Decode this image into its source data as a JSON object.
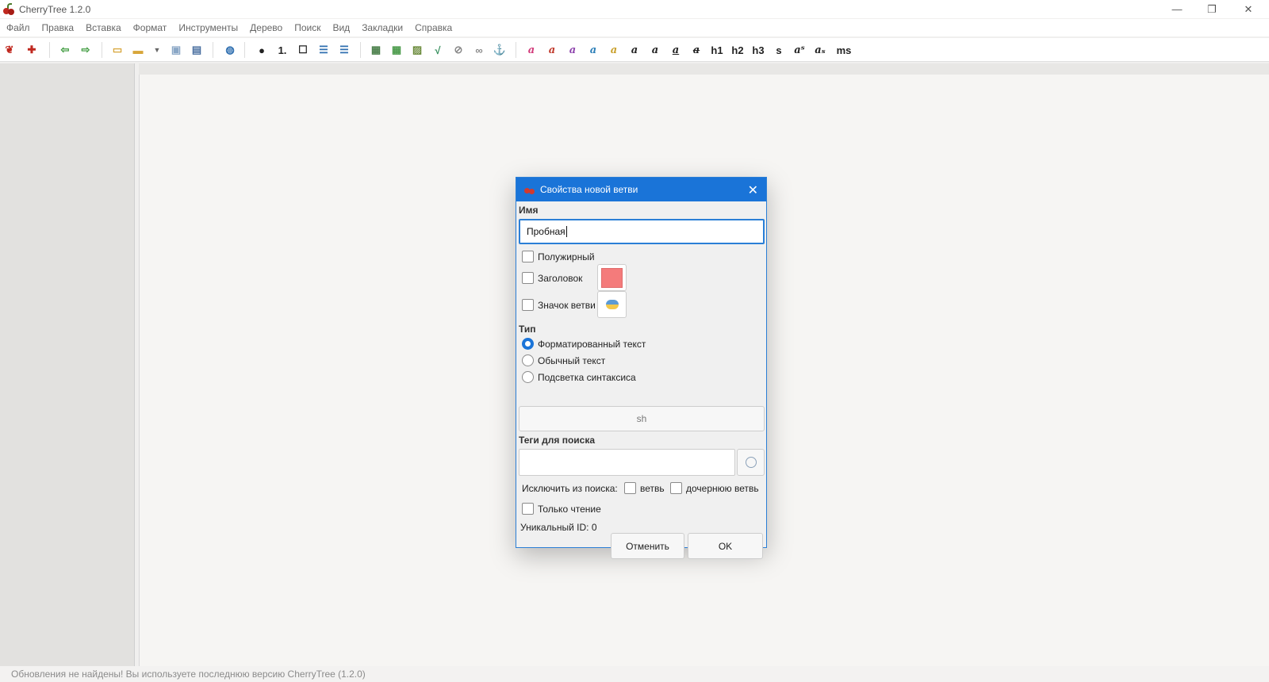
{
  "window": {
    "title": "CherryTree 1.2.0"
  },
  "menu": [
    "Файл",
    "Правка",
    "Вставка",
    "Формат",
    "Инструменты",
    "Дерево",
    "Поиск",
    "Вид",
    "Закладки",
    "Справка"
  ],
  "toolbar": {
    "fmt_labels": {
      "h1": "h1",
      "h2": "h2",
      "h3": "h3",
      "small": "s",
      "sup": "aˢ",
      "sub": "aₛ",
      "mono": "ms"
    }
  },
  "dialog": {
    "title": "Свойства новой ветви",
    "name_label": "Имя",
    "name_value": "Пробная",
    "bold_label": "Полужирный",
    "heading_label": "Заголовок",
    "heading_color": "#f47b7b",
    "icon_label": "Значок ветви",
    "type_label": "Тип",
    "type_options": [
      "Форматированный текст",
      "Обычный текст",
      "Подсветка синтаксиса"
    ],
    "type_selected": "Форматированный текст",
    "syntax_lang": "sh",
    "tags_label": "Теги для поиска",
    "tags_value": "",
    "exclude_label": "Исключить из поиска:",
    "exclude_branch": "ветвь",
    "exclude_child": "дочернюю ветвь",
    "readonly_label": "Только чтение",
    "unique_id": "Уникальный ID: 0",
    "cancel": "Отменить",
    "ok": "OK"
  },
  "status": "Обновления не найдены! Вы используете последнюю версию CherryTree (1.2.0)",
  "colors": {
    "accent": "#1a74d8"
  }
}
